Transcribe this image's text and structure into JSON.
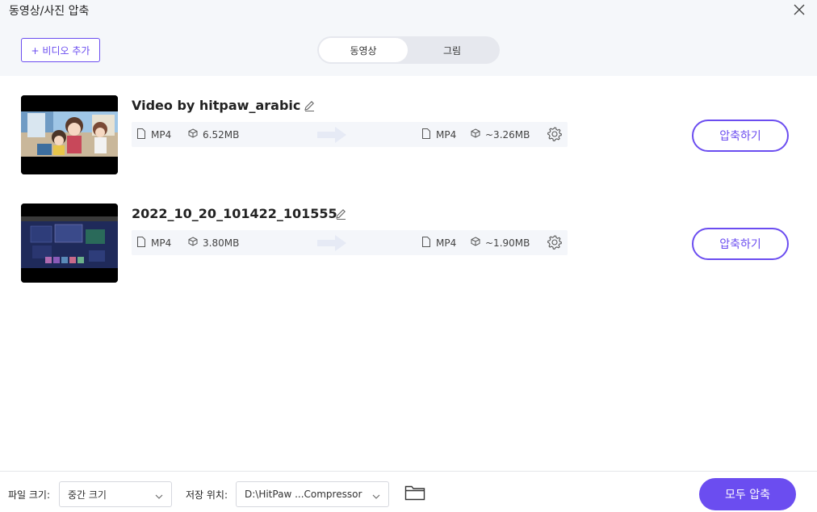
{
  "window": {
    "title": "동영상/사진 압축",
    "close_icon": "close-icon"
  },
  "toolbar": {
    "add_video_label": "+ 비디오 추가"
  },
  "tabs": [
    {
      "label": "동영상",
      "active": true
    },
    {
      "label": "그림",
      "active": false
    }
  ],
  "items": [
    {
      "title": "Video by hitpaw_arabic",
      "input_format": "MP4",
      "input_size": "6.52MB",
      "output_format": "MP4",
      "output_size": "~3.26MB",
      "button_label": "압축하기"
    },
    {
      "title": "2022_10_20_101422_101555",
      "input_format": "MP4",
      "input_size": "3.80MB",
      "output_format": "MP4",
      "output_size": "~1.90MB",
      "button_label": "압축하기"
    }
  ],
  "footer": {
    "file_size_label": "파일 크기:",
    "file_size_value": "중간 크기",
    "save_location_label": "저장 위치:",
    "save_location_value": "D:\\HitPaw ...Compressor",
    "compress_all_label": "모두 압축"
  },
  "colors": {
    "accent": "#6b4df0",
    "header_bg": "#f5f7fa",
    "info_bg": "#f4f6fa"
  }
}
